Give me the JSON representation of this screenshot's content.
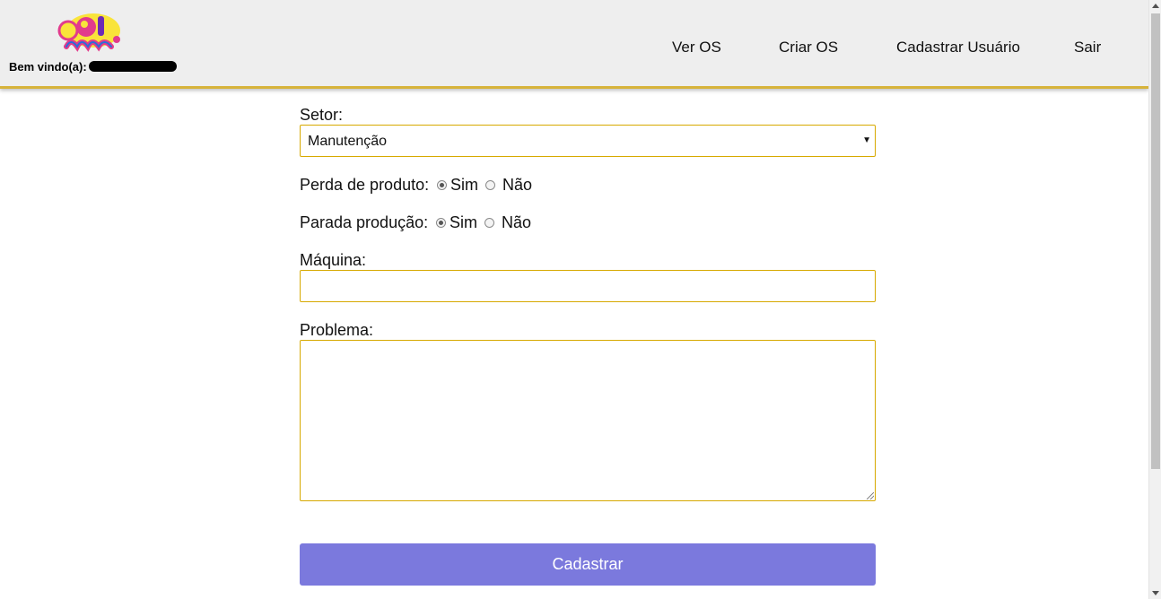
{
  "header": {
    "logo_text": "sol neve",
    "welcome_label": "Bem vindo(a):",
    "nav": [
      "Ver OS",
      "Criar OS",
      "Cadastrar Usuário",
      "Sair"
    ]
  },
  "form": {
    "setor_label": "Setor:",
    "setor_value": "Manutenção",
    "perda_label": "Perda de produto:",
    "parada_label": "Parada produção:",
    "radio_yes": "Sim",
    "radio_no": "Não",
    "perda_selected": "Sim",
    "parada_selected": "Sim",
    "maquina_label": "Máquina:",
    "maquina_value": "",
    "problema_label": "Problema:",
    "problema_value": "",
    "submit_label": "Cadastrar"
  },
  "colors": {
    "header_bg": "#eeeeee",
    "accent_border": "#d7a900",
    "submit_bg": "#7b79dd"
  }
}
